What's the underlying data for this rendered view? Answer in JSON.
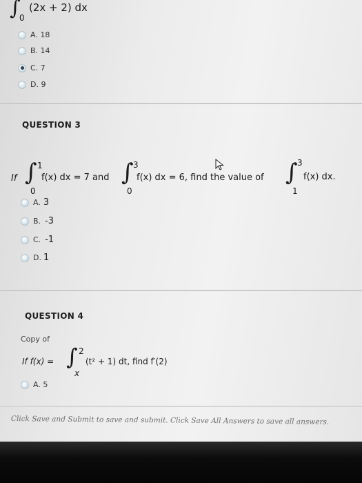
{
  "q2": {
    "integrand": "(2x + 2) dx",
    "lower": "0",
    "options": [
      {
        "label": "A. 18",
        "selected": false
      },
      {
        "label": "B. 14",
        "selected": false
      },
      {
        "label": "C. 7",
        "selected": true
      },
      {
        "label": "D. 9",
        "selected": false
      }
    ]
  },
  "q3": {
    "heading": "QUESTION 3",
    "text_if": "If",
    "int1": {
      "upper": "1",
      "lower": "0",
      "body": "f(x) dx = 7 and"
    },
    "int2": {
      "upper": "3",
      "lower": "0",
      "body": "f(x) dx = 6, find the value of"
    },
    "int3": {
      "upper": "3",
      "lower": "1",
      "body": "f(x) dx."
    },
    "options": [
      {
        "letter": "A.",
        "value": "3"
      },
      {
        "letter": "B.",
        "value": "-3"
      },
      {
        "letter": "C.",
        "value": "-1"
      },
      {
        "letter": "D.",
        "value": "1"
      }
    ]
  },
  "q4": {
    "heading": "QUESTION 4",
    "copy_of": "Copy of",
    "prefix": "If f(x) =",
    "upper": "2",
    "lower": "x",
    "body": "(t² + 1) dt, find f′(2)",
    "options": [
      {
        "label": "A. 5"
      }
    ]
  },
  "footer_note": "Click Save and Submit to save and submit. Click Save All Answers to save all answers."
}
